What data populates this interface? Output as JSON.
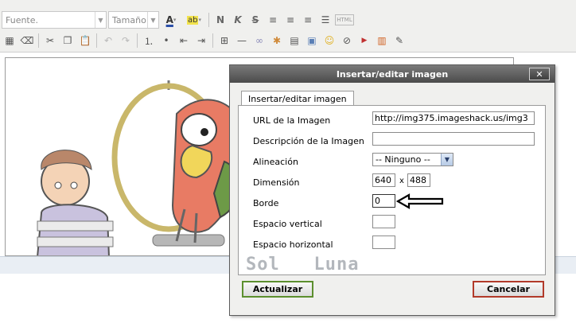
{
  "toolbar": {
    "font_combo": "Fuente.",
    "size_combo": "Tamaño",
    "bold": "N",
    "italic": "K",
    "strike": "S",
    "html": "HTML"
  },
  "dialog": {
    "title": "Insertar/editar imagen",
    "close": "✕",
    "tab": "Insertar/editar imagen",
    "fields": {
      "url_label": "URL de la Imagen",
      "url_value": "http://img375.imageshack.us/img3",
      "desc_label": "Descripción de la Imagen",
      "desc_value": "",
      "align_label": "Alineación",
      "align_value": "-- Ninguno --",
      "dim_label": "Dimensión",
      "width_value": "640",
      "dim_sep": "x",
      "height_value": "488",
      "border_label": "Borde",
      "border_value": "0",
      "vspace_label": "Espacio vertical",
      "vspace_value": "",
      "hspace_label": "Espacio horizontal",
      "hspace_value": ""
    },
    "watermark": "Sol   Luna",
    "update_button": "Actualizar",
    "cancel_button": "Cancelar"
  },
  "colors": {
    "ok_border": "#5c8f2e",
    "cancel_border": "#b23a2a",
    "title_bar": "#4b4b4b"
  }
}
